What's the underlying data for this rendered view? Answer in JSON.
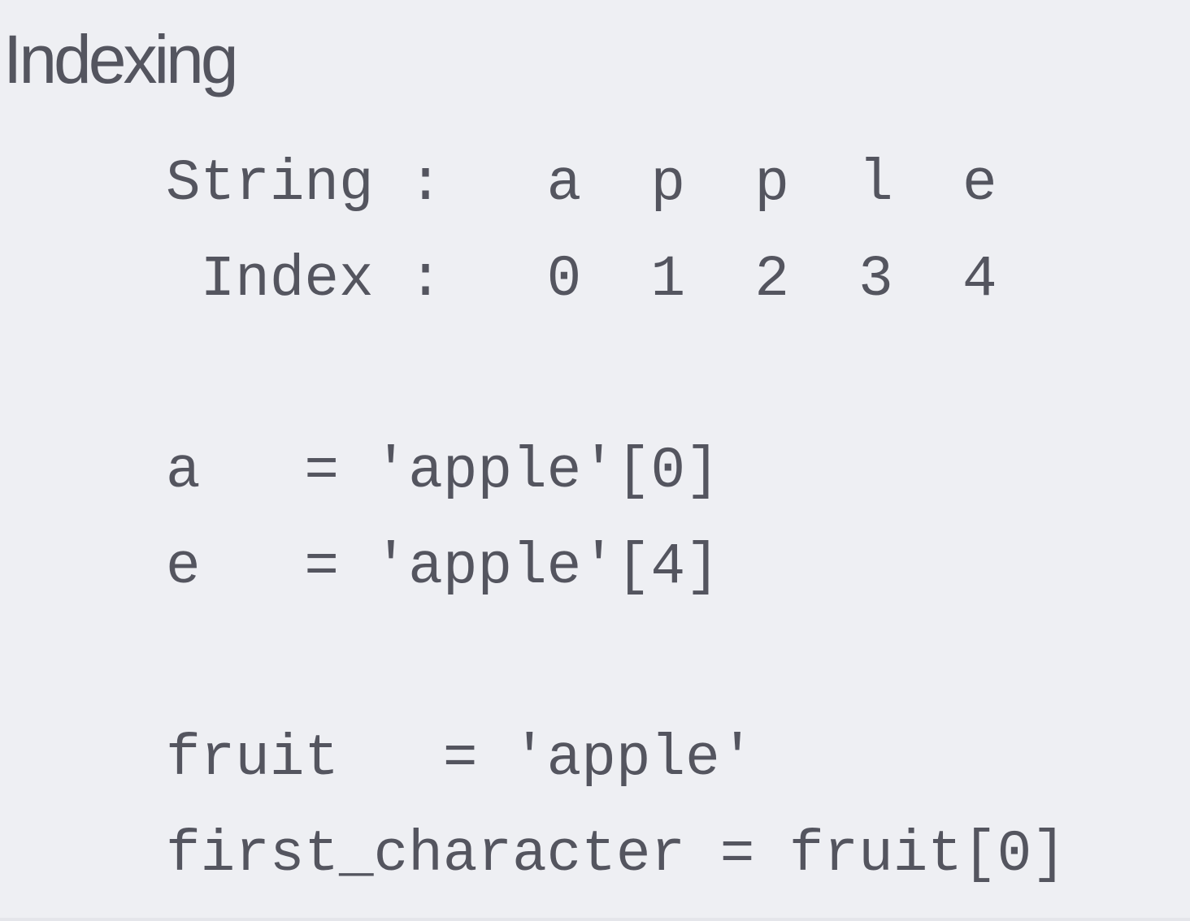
{
  "title": "Indexing",
  "code_lines": [
    "String :   a  p  p  l  e",
    " Index :   0  1  2  3  4",
    "",
    "a   = 'apple'[0]",
    "e   = 'apple'[4]",
    "",
    "fruit   = 'apple'",
    "first_character = fruit[0]"
  ]
}
